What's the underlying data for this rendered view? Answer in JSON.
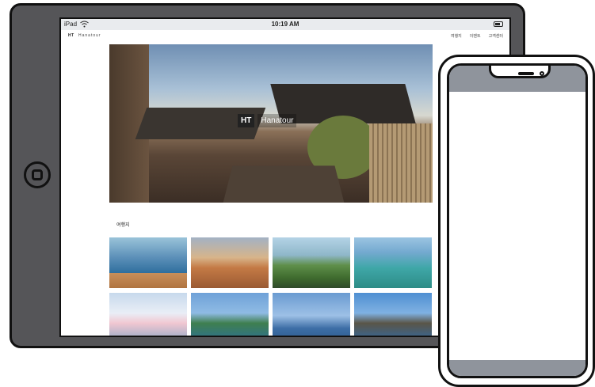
{
  "tablet": {
    "statusbar": {
      "device": "iPad",
      "time": "10:19 AM"
    },
    "site": {
      "logo_mark": "HT",
      "logo_name": "Hanatour",
      "nav": [
        "여행지",
        "이벤트",
        "고객센터"
      ]
    },
    "hero": {
      "logo_mark": "HT",
      "logo_name": "Hanatour"
    },
    "section_title": "여행지",
    "destinations": [
      {
        "name": "destination-1"
      },
      {
        "name": "destination-2"
      },
      {
        "name": "destination-3"
      },
      {
        "name": "destination-4"
      },
      {
        "name": "destination-5"
      },
      {
        "name": "destination-6"
      },
      {
        "name": "destination-7"
      },
      {
        "name": "destination-8"
      }
    ]
  },
  "icons": {
    "wifi": "wifi-icon",
    "battery": "battery-icon",
    "home_button": "home-button-icon"
  }
}
